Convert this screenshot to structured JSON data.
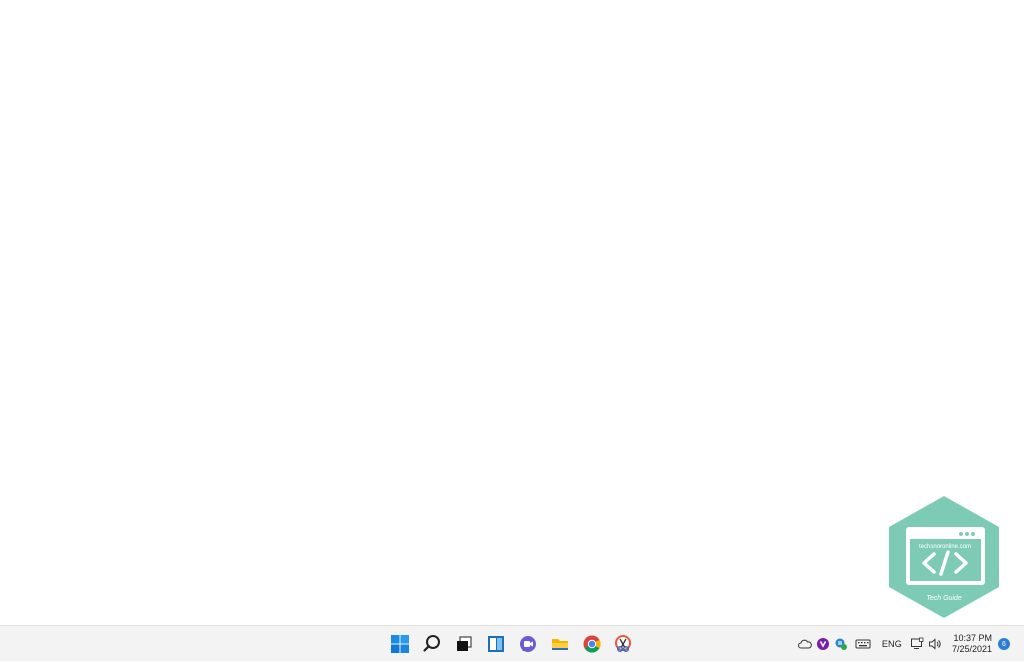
{
  "watermark": {
    "site": "techsnoronline.com",
    "caption": "Tech Guide",
    "color": "#7ecbb5"
  },
  "taskbar": {
    "apps": [
      {
        "name": "start",
        "icon": "windows-logo-icon"
      },
      {
        "name": "search",
        "icon": "search-icon"
      },
      {
        "name": "task-view",
        "icon": "task-view-icon"
      },
      {
        "name": "widgets",
        "icon": "widgets-icon"
      },
      {
        "name": "chat",
        "icon": "teams-chat-icon"
      },
      {
        "name": "file-explorer",
        "icon": "folder-icon"
      },
      {
        "name": "chrome",
        "icon": "chrome-icon"
      },
      {
        "name": "snipping-tool",
        "icon": "snipping-tool-icon"
      }
    ],
    "tray": {
      "icons": [
        "onedrive-cloud-icon",
        "app-tray-icon",
        "security-icon",
        "keyboard-icon",
        "network-icon",
        "volume-icon"
      ],
      "language": "ENG",
      "time": "10:37 PM",
      "date": "7/25/2021",
      "notification_count": "6"
    },
    "accent": "#0078d4"
  }
}
